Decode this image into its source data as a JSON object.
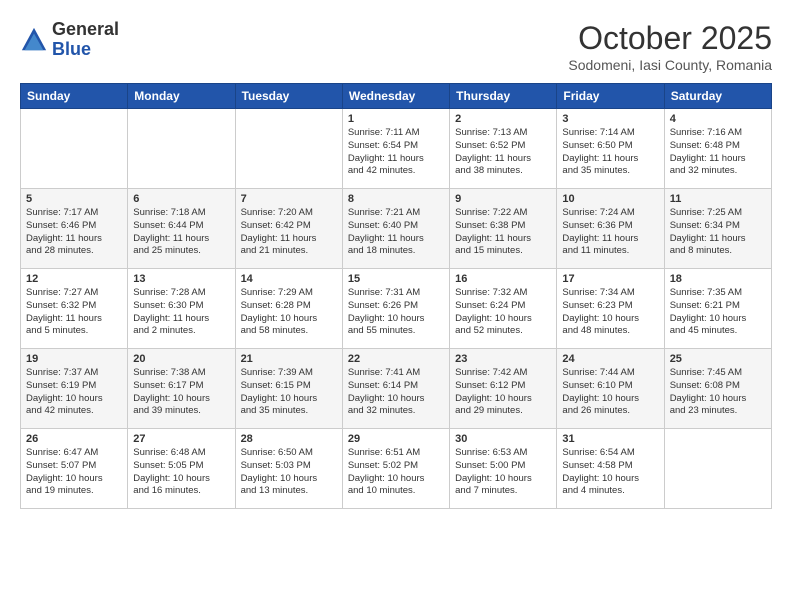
{
  "header": {
    "logo": {
      "general": "General",
      "blue": "Blue"
    },
    "title": "October 2025",
    "subtitle": "Sodomeni, Iasi County, Romania"
  },
  "calendar": {
    "weekdays": [
      "Sunday",
      "Monday",
      "Tuesday",
      "Wednesday",
      "Thursday",
      "Friday",
      "Saturday"
    ],
    "weeks": [
      [
        {
          "day": "",
          "info": ""
        },
        {
          "day": "",
          "info": ""
        },
        {
          "day": "",
          "info": ""
        },
        {
          "day": "1",
          "info": "Sunrise: 7:11 AM\nSunset: 6:54 PM\nDaylight: 11 hours\nand 42 minutes."
        },
        {
          "day": "2",
          "info": "Sunrise: 7:13 AM\nSunset: 6:52 PM\nDaylight: 11 hours\nand 38 minutes."
        },
        {
          "day": "3",
          "info": "Sunrise: 7:14 AM\nSunset: 6:50 PM\nDaylight: 11 hours\nand 35 minutes."
        },
        {
          "day": "4",
          "info": "Sunrise: 7:16 AM\nSunset: 6:48 PM\nDaylight: 11 hours\nand 32 minutes."
        }
      ],
      [
        {
          "day": "5",
          "info": "Sunrise: 7:17 AM\nSunset: 6:46 PM\nDaylight: 11 hours\nand 28 minutes."
        },
        {
          "day": "6",
          "info": "Sunrise: 7:18 AM\nSunset: 6:44 PM\nDaylight: 11 hours\nand 25 minutes."
        },
        {
          "day": "7",
          "info": "Sunrise: 7:20 AM\nSunset: 6:42 PM\nDaylight: 11 hours\nand 21 minutes."
        },
        {
          "day": "8",
          "info": "Sunrise: 7:21 AM\nSunset: 6:40 PM\nDaylight: 11 hours\nand 18 minutes."
        },
        {
          "day": "9",
          "info": "Sunrise: 7:22 AM\nSunset: 6:38 PM\nDaylight: 11 hours\nand 15 minutes."
        },
        {
          "day": "10",
          "info": "Sunrise: 7:24 AM\nSunset: 6:36 PM\nDaylight: 11 hours\nand 11 minutes."
        },
        {
          "day": "11",
          "info": "Sunrise: 7:25 AM\nSunset: 6:34 PM\nDaylight: 11 hours\nand 8 minutes."
        }
      ],
      [
        {
          "day": "12",
          "info": "Sunrise: 7:27 AM\nSunset: 6:32 PM\nDaylight: 11 hours\nand 5 minutes."
        },
        {
          "day": "13",
          "info": "Sunrise: 7:28 AM\nSunset: 6:30 PM\nDaylight: 11 hours\nand 2 minutes."
        },
        {
          "day": "14",
          "info": "Sunrise: 7:29 AM\nSunset: 6:28 PM\nDaylight: 10 hours\nand 58 minutes."
        },
        {
          "day": "15",
          "info": "Sunrise: 7:31 AM\nSunset: 6:26 PM\nDaylight: 10 hours\nand 55 minutes."
        },
        {
          "day": "16",
          "info": "Sunrise: 7:32 AM\nSunset: 6:24 PM\nDaylight: 10 hours\nand 52 minutes."
        },
        {
          "day": "17",
          "info": "Sunrise: 7:34 AM\nSunset: 6:23 PM\nDaylight: 10 hours\nand 48 minutes."
        },
        {
          "day": "18",
          "info": "Sunrise: 7:35 AM\nSunset: 6:21 PM\nDaylight: 10 hours\nand 45 minutes."
        }
      ],
      [
        {
          "day": "19",
          "info": "Sunrise: 7:37 AM\nSunset: 6:19 PM\nDaylight: 10 hours\nand 42 minutes."
        },
        {
          "day": "20",
          "info": "Sunrise: 7:38 AM\nSunset: 6:17 PM\nDaylight: 10 hours\nand 39 minutes."
        },
        {
          "day": "21",
          "info": "Sunrise: 7:39 AM\nSunset: 6:15 PM\nDaylight: 10 hours\nand 35 minutes."
        },
        {
          "day": "22",
          "info": "Sunrise: 7:41 AM\nSunset: 6:14 PM\nDaylight: 10 hours\nand 32 minutes."
        },
        {
          "day": "23",
          "info": "Sunrise: 7:42 AM\nSunset: 6:12 PM\nDaylight: 10 hours\nand 29 minutes."
        },
        {
          "day": "24",
          "info": "Sunrise: 7:44 AM\nSunset: 6:10 PM\nDaylight: 10 hours\nand 26 minutes."
        },
        {
          "day": "25",
          "info": "Sunrise: 7:45 AM\nSunset: 6:08 PM\nDaylight: 10 hours\nand 23 minutes."
        }
      ],
      [
        {
          "day": "26",
          "info": "Sunrise: 6:47 AM\nSunset: 5:07 PM\nDaylight: 10 hours\nand 19 minutes."
        },
        {
          "day": "27",
          "info": "Sunrise: 6:48 AM\nSunset: 5:05 PM\nDaylight: 10 hours\nand 16 minutes."
        },
        {
          "day": "28",
          "info": "Sunrise: 6:50 AM\nSunset: 5:03 PM\nDaylight: 10 hours\nand 13 minutes."
        },
        {
          "day": "29",
          "info": "Sunrise: 6:51 AM\nSunset: 5:02 PM\nDaylight: 10 hours\nand 10 minutes."
        },
        {
          "day": "30",
          "info": "Sunrise: 6:53 AM\nSunset: 5:00 PM\nDaylight: 10 hours\nand 7 minutes."
        },
        {
          "day": "31",
          "info": "Sunrise: 6:54 AM\nSunset: 4:58 PM\nDaylight: 10 hours\nand 4 minutes."
        },
        {
          "day": "",
          "info": ""
        }
      ]
    ]
  }
}
